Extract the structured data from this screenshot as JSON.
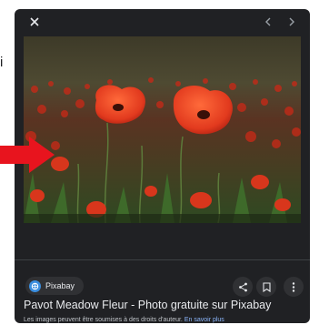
{
  "background": {
    "partial_text": "i"
  },
  "viewer": {
    "close_icon": "close-icon",
    "prev_icon": "chevron-left-icon",
    "next_icon": "chevron-right-icon",
    "image": {
      "subject": "red poppies in a meadow",
      "colors": {
        "sky": "#4a4530",
        "field": "#3f5a2a",
        "poppy": "#e23a1e",
        "poppy_dark": "#a51c10"
      }
    },
    "source": {
      "label": "Pixabay",
      "logo_color": "#3a8dde"
    },
    "actions": {
      "share_icon": "share-icon",
      "save_icon": "bookmark-icon",
      "more_icon": "more-vert-icon"
    },
    "title": "Pavot Meadow Fleur - Photo gratuite sur Pixabay",
    "notice_text": "Les images peuvent être soumises à des droits d'auteur.",
    "learn_more": "En savoir plus"
  },
  "annotation": {
    "arrow_color": "#e8141e"
  },
  "colors": {
    "panel_bg": "#202124",
    "text_primary": "#e8eaed",
    "link": "#8ab4f8"
  }
}
